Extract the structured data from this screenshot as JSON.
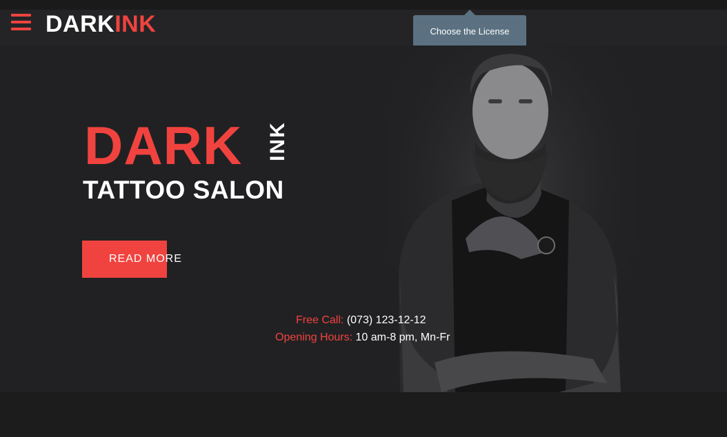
{
  "header": {
    "logo_part1": "DARK",
    "logo_part2": "INK",
    "menu_icon": "hamburger-menu-icon"
  },
  "tooltip": {
    "label": "Choose the License"
  },
  "hero": {
    "title": "DARK",
    "title_vertical": "INK",
    "subtitle": "TATTOO SALON",
    "button_label": "READ MORE",
    "photo": "tattooed-man-portrait"
  },
  "contact": {
    "call_label": "Free Call:",
    "call_value": "(073) 123-12-12",
    "hours_label": "Opening Hours:",
    "hours_value": "10 am-8 pm, Mn-Fr"
  },
  "colors": {
    "accent": "#f0433f",
    "background": "#212123",
    "tooltip": "#5b7181"
  }
}
